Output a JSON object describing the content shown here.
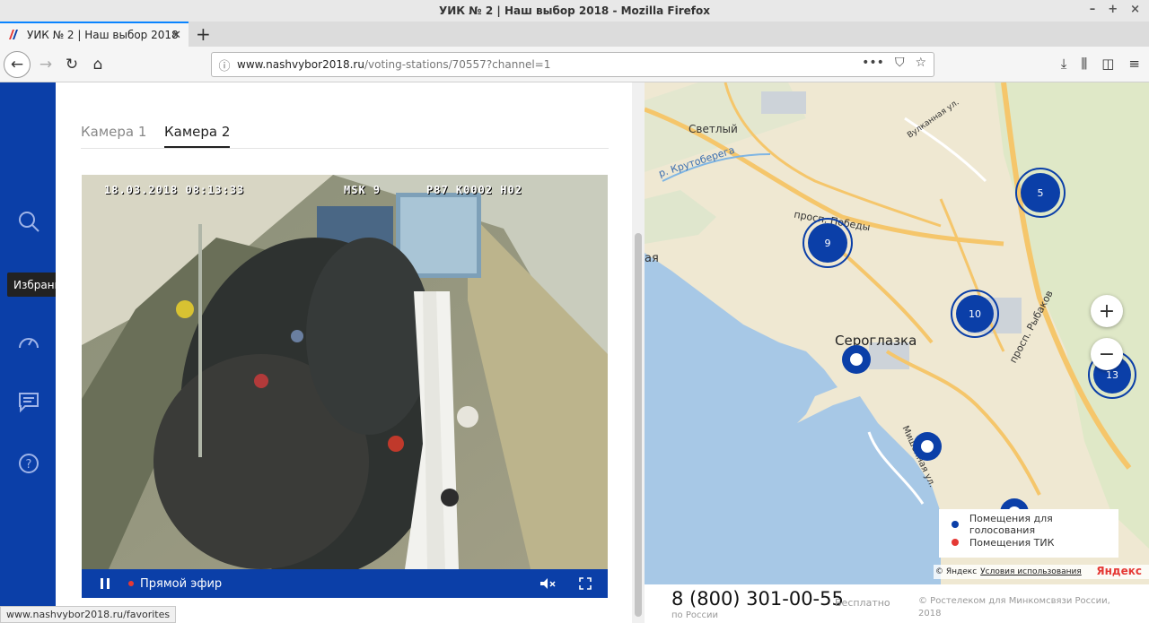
{
  "window": {
    "title": "УИК № 2 | Наш выбор 2018 - Mozilla Firefox",
    "controls": [
      "–",
      "+",
      "×"
    ]
  },
  "browser": {
    "tab_title": "УИК № 2 | Наш выбор 2018",
    "url_host": "www.nashvybor2018.ru",
    "url_path": "/voting-stations/70557?channel=1",
    "status_url": "www.nashvybor2018.ru/favorites"
  },
  "sidebar": {
    "tooltip": "Избранное",
    "icons": [
      "search-icon",
      "favorites-icon",
      "speedometer-icon",
      "chat-icon",
      "help-icon"
    ]
  },
  "camera": {
    "tabs": [
      "Камера 1",
      "Камера 2"
    ],
    "active_tab": 1,
    "osd_datetime": "18.03.2018 08:13:33",
    "osd_zone": "MSK 9",
    "osd_code": "P87 K0002 H02",
    "live_label": "Прямой эфир"
  },
  "map": {
    "labels": {
      "svetly": "Светлый",
      "krutoberega": "р. Крутоберега",
      "vulkannaya": "Вулканная ул.",
      "pobedy": "просп. Победы",
      "seroglazka": "Сероглазка",
      "rybakov": "просп. Рыбаков",
      "mishennaya": "Мишенная ул.",
      "edge": "ая"
    },
    "clusters": [
      {
        "count": "5"
      },
      {
        "count": "9"
      },
      {
        "count": "10"
      },
      {
        "count": "13"
      }
    ],
    "zoom_in": "+",
    "zoom_out": "−",
    "legend": [
      {
        "label": "Помещения для голосования",
        "color": "#0b3fa8"
      },
      {
        "label": "Помещения ТИК",
        "color": "#e53935"
      }
    ],
    "copyright": "© Яндекс",
    "terms": "Условия использования",
    "yandex_logo": "Яндекс"
  },
  "footer": {
    "phone": "8 (800) 301-00-55",
    "phone_sub": "по России",
    "free": "Бесплатно",
    "rostelecom": "© Ростелеком для Минкомсвязи России, 2018"
  },
  "colors": {
    "brand_blue": "#0b3fa8",
    "live_red": "#e53935"
  }
}
